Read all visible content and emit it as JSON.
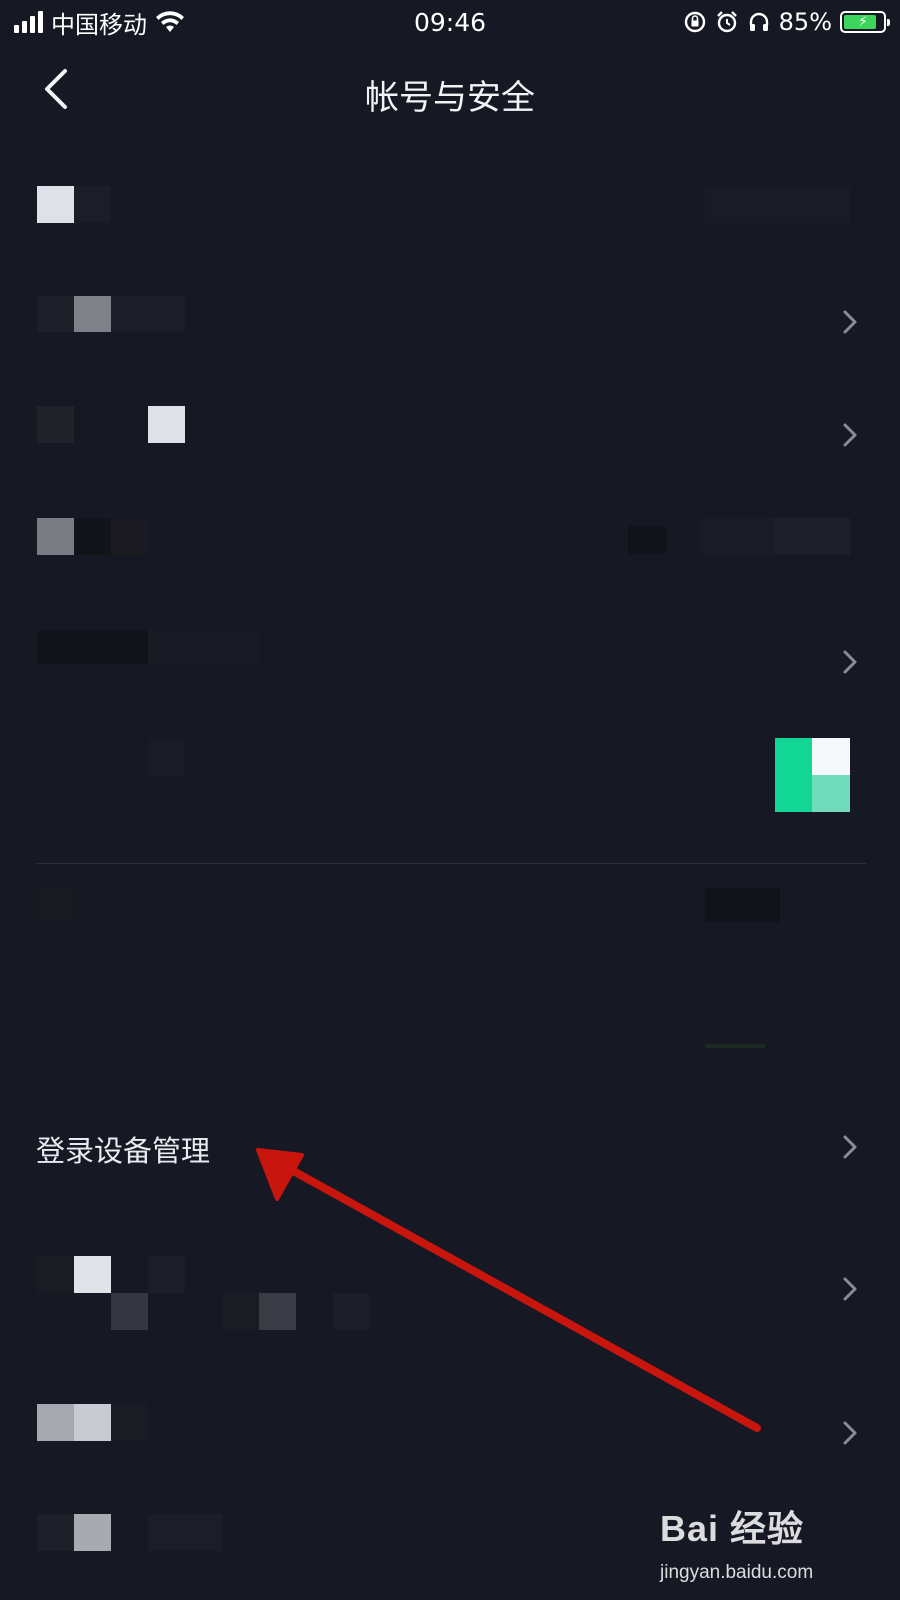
{
  "status_bar": {
    "carrier": "中国移动",
    "time": "09:46",
    "battery_percent": "85%",
    "battery_level": 0.85,
    "icons": [
      "signal-icon",
      "wifi-icon",
      "rotation-lock-icon",
      "alarm-icon",
      "headphones-icon",
      "battery-icon"
    ]
  },
  "header": {
    "title": "帐号与安全",
    "back_icon": "chevron-left-icon"
  },
  "settings_list": {
    "items": [
      {
        "label": "",
        "has_chevron": false,
        "note": ""
      },
      {
        "label": "",
        "has_chevron": true
      },
      {
        "label": "",
        "has_chevron": true
      },
      {
        "label": "",
        "has_chevron": false
      },
      {
        "label": "",
        "has_chevron": true
      },
      {
        "label": "",
        "has_chevron": false,
        "toggle": "on"
      },
      {
        "label": "",
        "has_chevron": false
      },
      {
        "label": "",
        "has_chevron": false
      },
      {
        "label": "登录设备管理",
        "has_chevron": true
      },
      {
        "label": "",
        "has_chevron": true
      },
      {
        "label": "",
        "has_chevron": true
      },
      {
        "label": "",
        "has_chevron": true
      }
    ]
  },
  "colors": {
    "background": "#161823",
    "text": "#e9eaef",
    "chevron": "#8a8b93",
    "toggle_on": "#12d694",
    "annotation_arrow": "#c8160f"
  },
  "watermark": {
    "brand": "Bai 经验",
    "url": "jingyan.baidu.com"
  }
}
